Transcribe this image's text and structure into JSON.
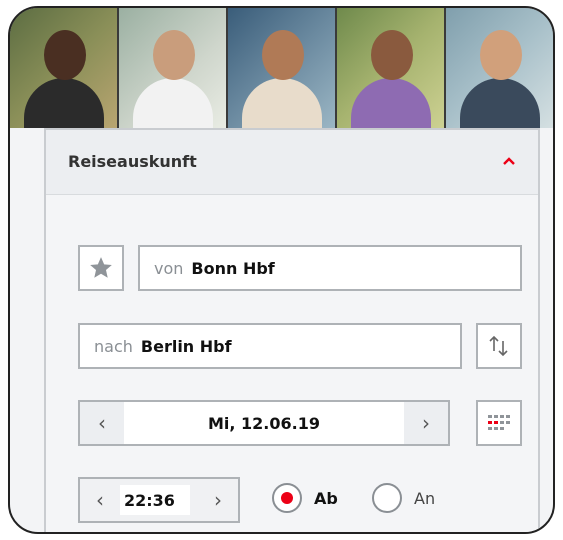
{
  "colors": {
    "accent": "#ec0016",
    "border": "#aeb2b6",
    "text": "#111111",
    "muted": "#8a8f94"
  },
  "photos": [
    {
      "name": "man-eating-sandwich"
    },
    {
      "name": "man-writing"
    },
    {
      "name": "woman-with-tablet"
    },
    {
      "name": "family-hug"
    },
    {
      "name": "man-with-cup"
    }
  ],
  "panel": {
    "title": "Reiseauskunft",
    "collapse_icon": "chevron-up-icon"
  },
  "from": {
    "prefix": "von",
    "value": "Bonn Hbf",
    "favorite_icon": "star-icon"
  },
  "to": {
    "prefix": "nach",
    "value": "Berlin Hbf",
    "swap_icon": "swap-arrows-icon"
  },
  "date": {
    "prev": "‹",
    "value": "Mi, 12.06.19",
    "next": "›",
    "calendar_icon": "calendar-icon"
  },
  "time": {
    "prev": "‹",
    "value": "22:36",
    "next": "›"
  },
  "mode": {
    "departure_label": "Ab",
    "arrival_label": "An",
    "selected": "Ab"
  }
}
